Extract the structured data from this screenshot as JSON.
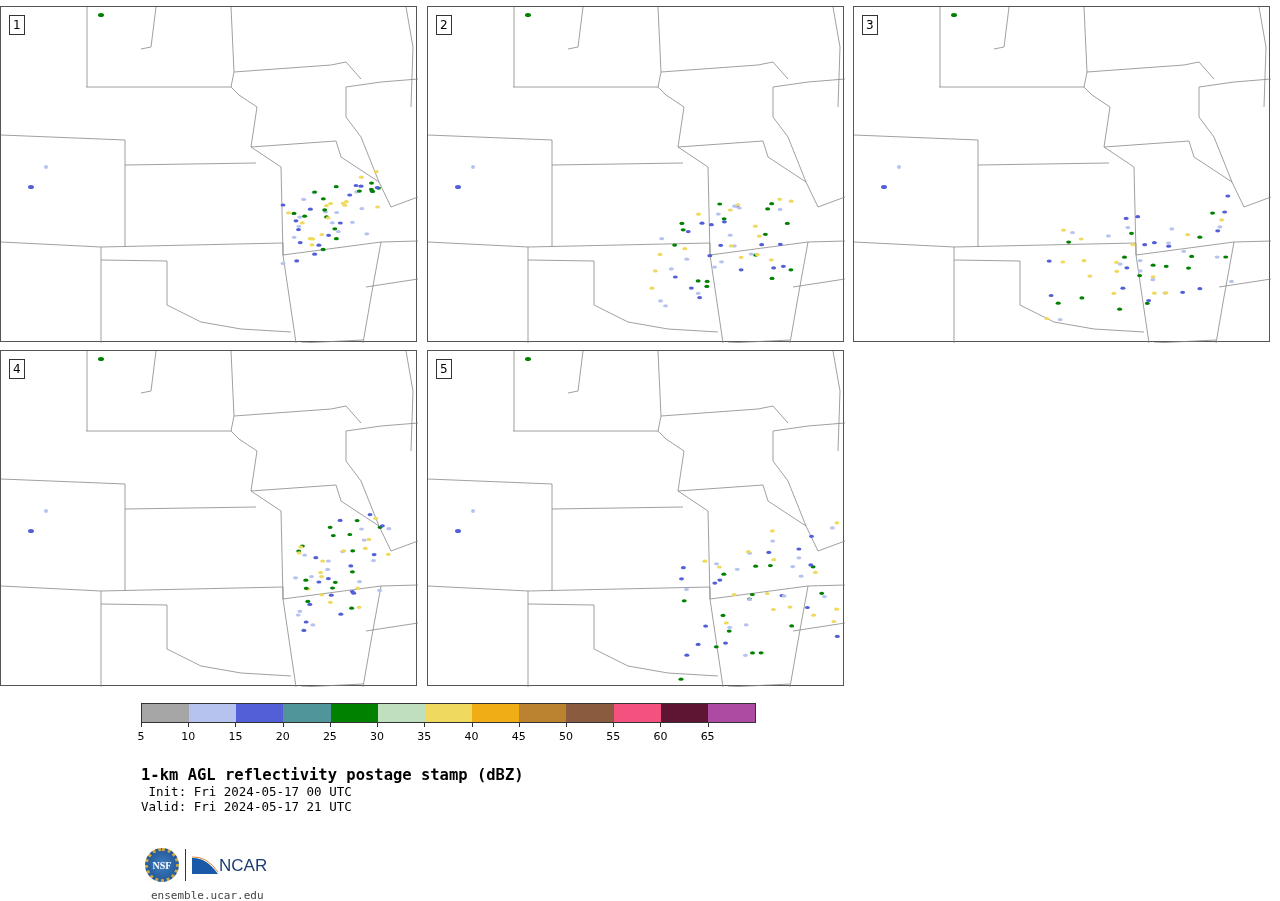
{
  "panels": [
    {
      "label": "1"
    },
    {
      "label": "2"
    },
    {
      "label": "3"
    },
    {
      "label": "4"
    },
    {
      "label": "5"
    }
  ],
  "colorbar": {
    "bins": [
      {
        "color": "#a6a6a6"
      },
      {
        "color": "#b6c3ee"
      },
      {
        "color": "#525fd6"
      },
      {
        "color": "#50959a"
      },
      {
        "color": "#008100"
      },
      {
        "color": "#bfdfbf"
      },
      {
        "color": "#efda5f"
      },
      {
        "color": "#f0ad15"
      },
      {
        "color": "#bb8330"
      },
      {
        "color": "#8a5b3e"
      },
      {
        "color": "#f5517f"
      },
      {
        "color": "#5e1533"
      },
      {
        "color": "#ad4ba3"
      }
    ],
    "ticks": [
      "5",
      "10",
      "15",
      "20",
      "25",
      "30",
      "35",
      "40",
      "45",
      "50",
      "55",
      "60",
      "65"
    ]
  },
  "title": "1-km AGL reflectivity postage stamp (dBZ)",
  "init": " Init: Fri 2024-05-17 00 UTC",
  "valid": "Valid: Fri 2024-05-17 21 UTC",
  "logos": {
    "nsf": "NSF",
    "ncar": "NCAR"
  },
  "site": "ensemble.ucar.edu"
}
